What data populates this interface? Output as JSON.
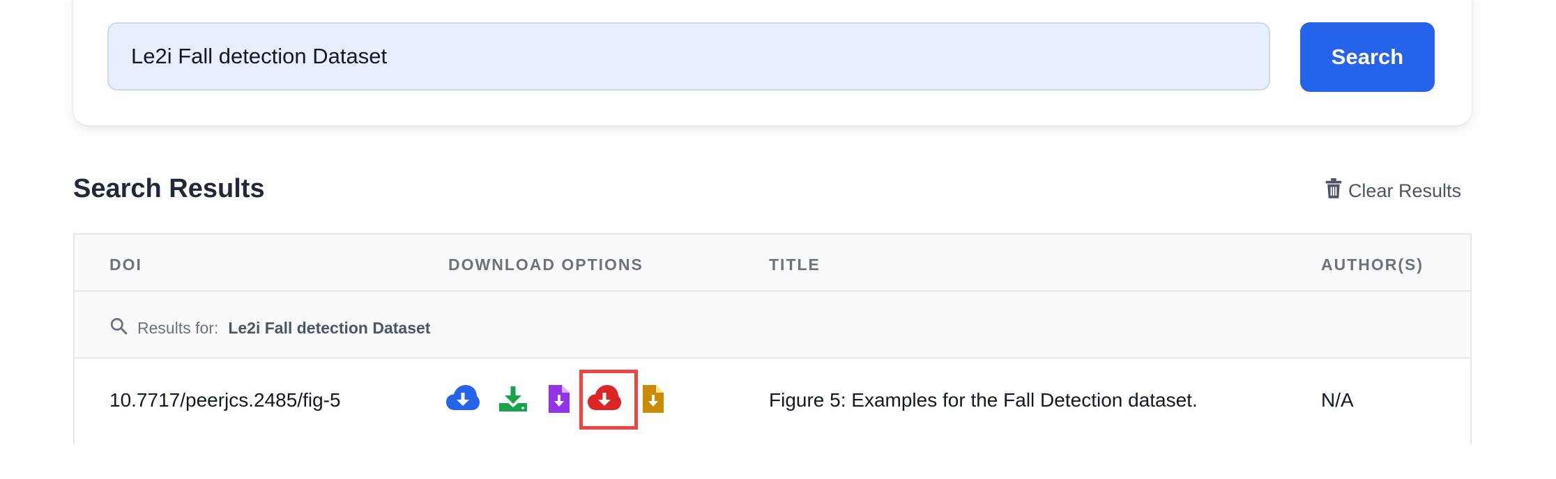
{
  "search": {
    "query": "Le2i Fall detection Dataset",
    "button_label": "Search"
  },
  "results": {
    "heading": "Search Results",
    "clear_label": "Clear Results",
    "columns": [
      "DOI",
      "DOWNLOAD OPTIONS",
      "TITLE",
      "AUTHOR(S)"
    ],
    "info_prefix": "Results for:",
    "info_query": "Le2i Fall detection Dataset",
    "rows": [
      {
        "doi": "10.7717/peerjcs.2485/fig-5",
        "download_icons": [
          "cloud-download-icon-blue",
          "download-tray-icon-green",
          "file-download-icon-purple",
          "cloud-download-icon-red",
          "file-download-icon-orange"
        ],
        "title": "Figure 5: Examples for the Fall Detection dataset.",
        "authors": "N/A"
      }
    ]
  },
  "colors": {
    "accent": "#2563eb",
    "green": "#16a34a",
    "purple": "#9333ea",
    "red": "#dc2626",
    "orange": "#ca8a04",
    "highlight": "#ef4444"
  }
}
